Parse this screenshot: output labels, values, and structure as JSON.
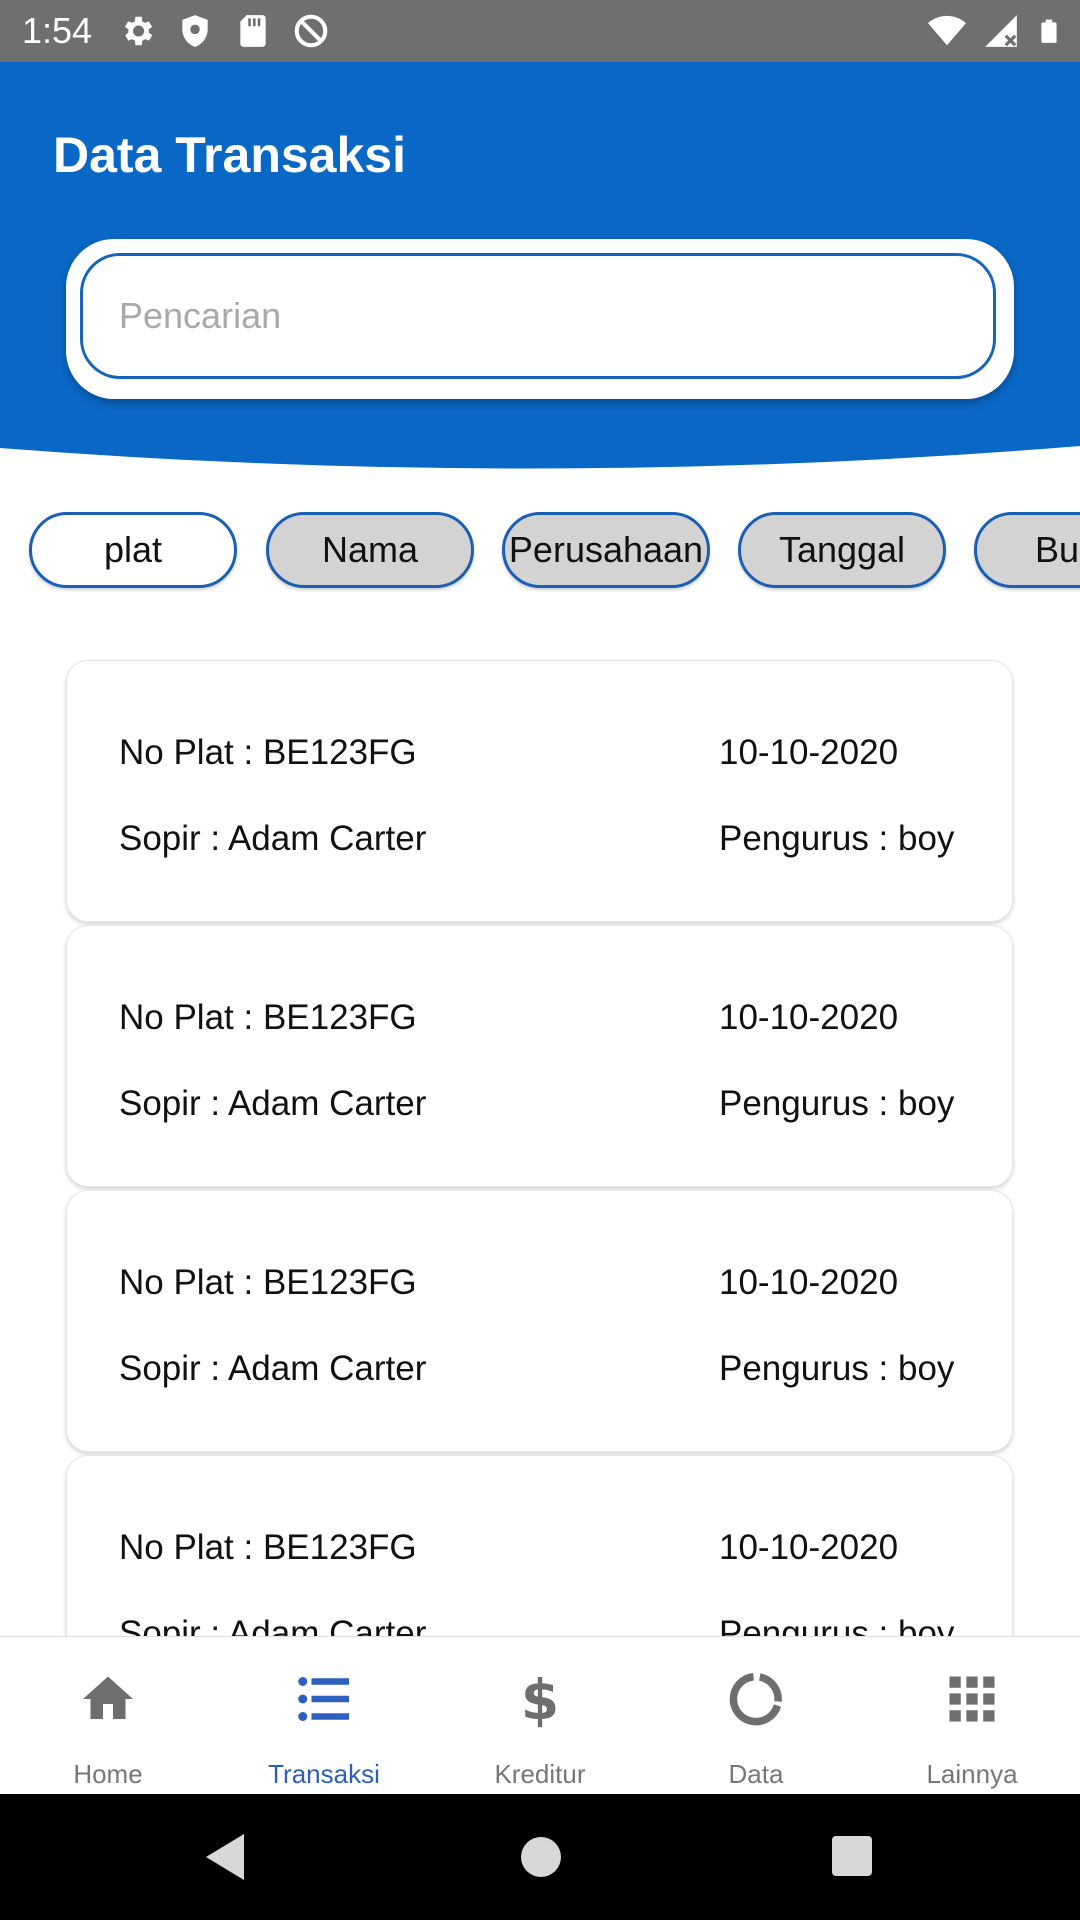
{
  "status_bar": {
    "time": "1:54",
    "left_icons": [
      "gear-icon",
      "shield-icon",
      "sd-card-icon",
      "no-sync-icon"
    ],
    "right_icons": [
      "wifi-icon",
      "signal-icon",
      "battery-icon"
    ]
  },
  "header": {
    "title": "Data Transaksi",
    "background_color": "#0967c5"
  },
  "search": {
    "placeholder": "Pencarian",
    "value": ""
  },
  "filters": {
    "chips": [
      {
        "label": "plat",
        "selected": true
      },
      {
        "label": "Nama",
        "selected": false
      },
      {
        "label": "Perusahaan",
        "selected": false
      },
      {
        "label": "Tanggal",
        "selected": false
      },
      {
        "label": "Bu",
        "selected": false
      }
    ],
    "accent": "#1a5fb4"
  },
  "transactions": [
    {
      "no_plat": "No Plat : BE123FG",
      "date": "10-10-2020",
      "sopir": "Sopir : Adam Carter",
      "pengurus": "Pengurus : boy"
    },
    {
      "no_plat": "No Plat : BE123FG",
      "date": "10-10-2020",
      "sopir": "Sopir : Adam Carter",
      "pengurus": "Pengurus : boy"
    },
    {
      "no_plat": "No Plat : BE123FG",
      "date": "10-10-2020",
      "sopir": "Sopir : Adam Carter",
      "pengurus": "Pengurus : boy"
    },
    {
      "no_plat": "No Plat : BE123FG",
      "date": "10-10-2020",
      "sopir": "Sopir : Adam Carter",
      "pengurus": "Pengurus : boy"
    }
  ],
  "bottom_nav": {
    "items": [
      {
        "label": "Home",
        "icon": "home-icon",
        "active": false
      },
      {
        "label": "Transaksi",
        "icon": "list-icon",
        "active": true
      },
      {
        "label": "Kreditur",
        "icon": "dollar-icon",
        "active": false
      },
      {
        "label": "Data",
        "icon": "donut-chart-icon",
        "active": false
      },
      {
        "label": "Lainnya",
        "icon": "apps-grid-icon",
        "active": false
      }
    ],
    "active_color": "#2c5fbe",
    "inactive_color": "#777777"
  },
  "system_nav": {
    "buttons": [
      "back-icon",
      "home-circle-icon",
      "recents-icon"
    ]
  }
}
